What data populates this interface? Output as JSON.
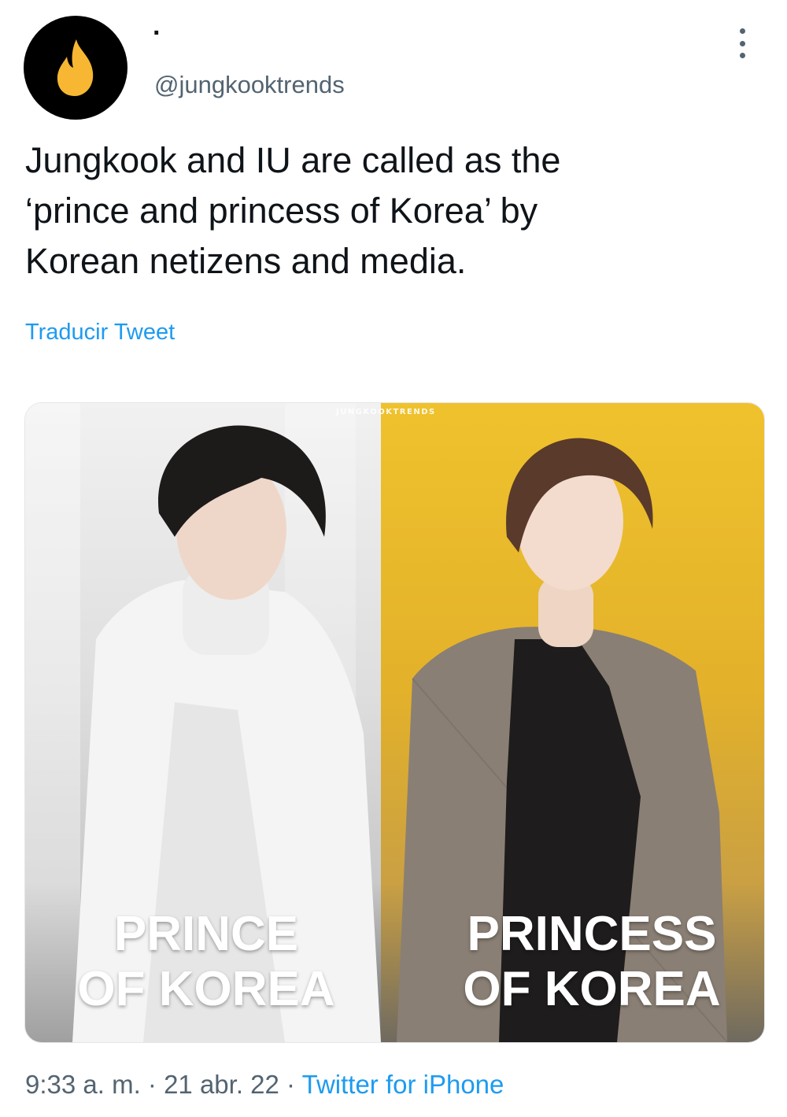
{
  "tweet": {
    "display_name": "·",
    "handle": "@jungkooktrends",
    "text": "Jungkook and IU are called as the\n‘prince and princess of Korea’ by\nKorean netizens and media.",
    "translate_label": "Traducir Tweet",
    "media": {
      "watermark": "JUNGKOOKTRENDS",
      "left_caption": [
        "PRINCE",
        "OF KOREA"
      ],
      "right_caption": [
        "PRINCESS",
        "OF KOREA"
      ]
    },
    "meta": {
      "time": "9:33 a. m.",
      "separator": " · ",
      "date": "21 abr. 22",
      "source": "Twitter for iPhone"
    }
  },
  "colors": {
    "link": "#1d9bf0",
    "secondary_text": "#536471",
    "avatar_bg": "#000000",
    "flame": "#f7b733"
  },
  "icons": {
    "avatar": "flame-icon",
    "more": "more-options-icon"
  }
}
